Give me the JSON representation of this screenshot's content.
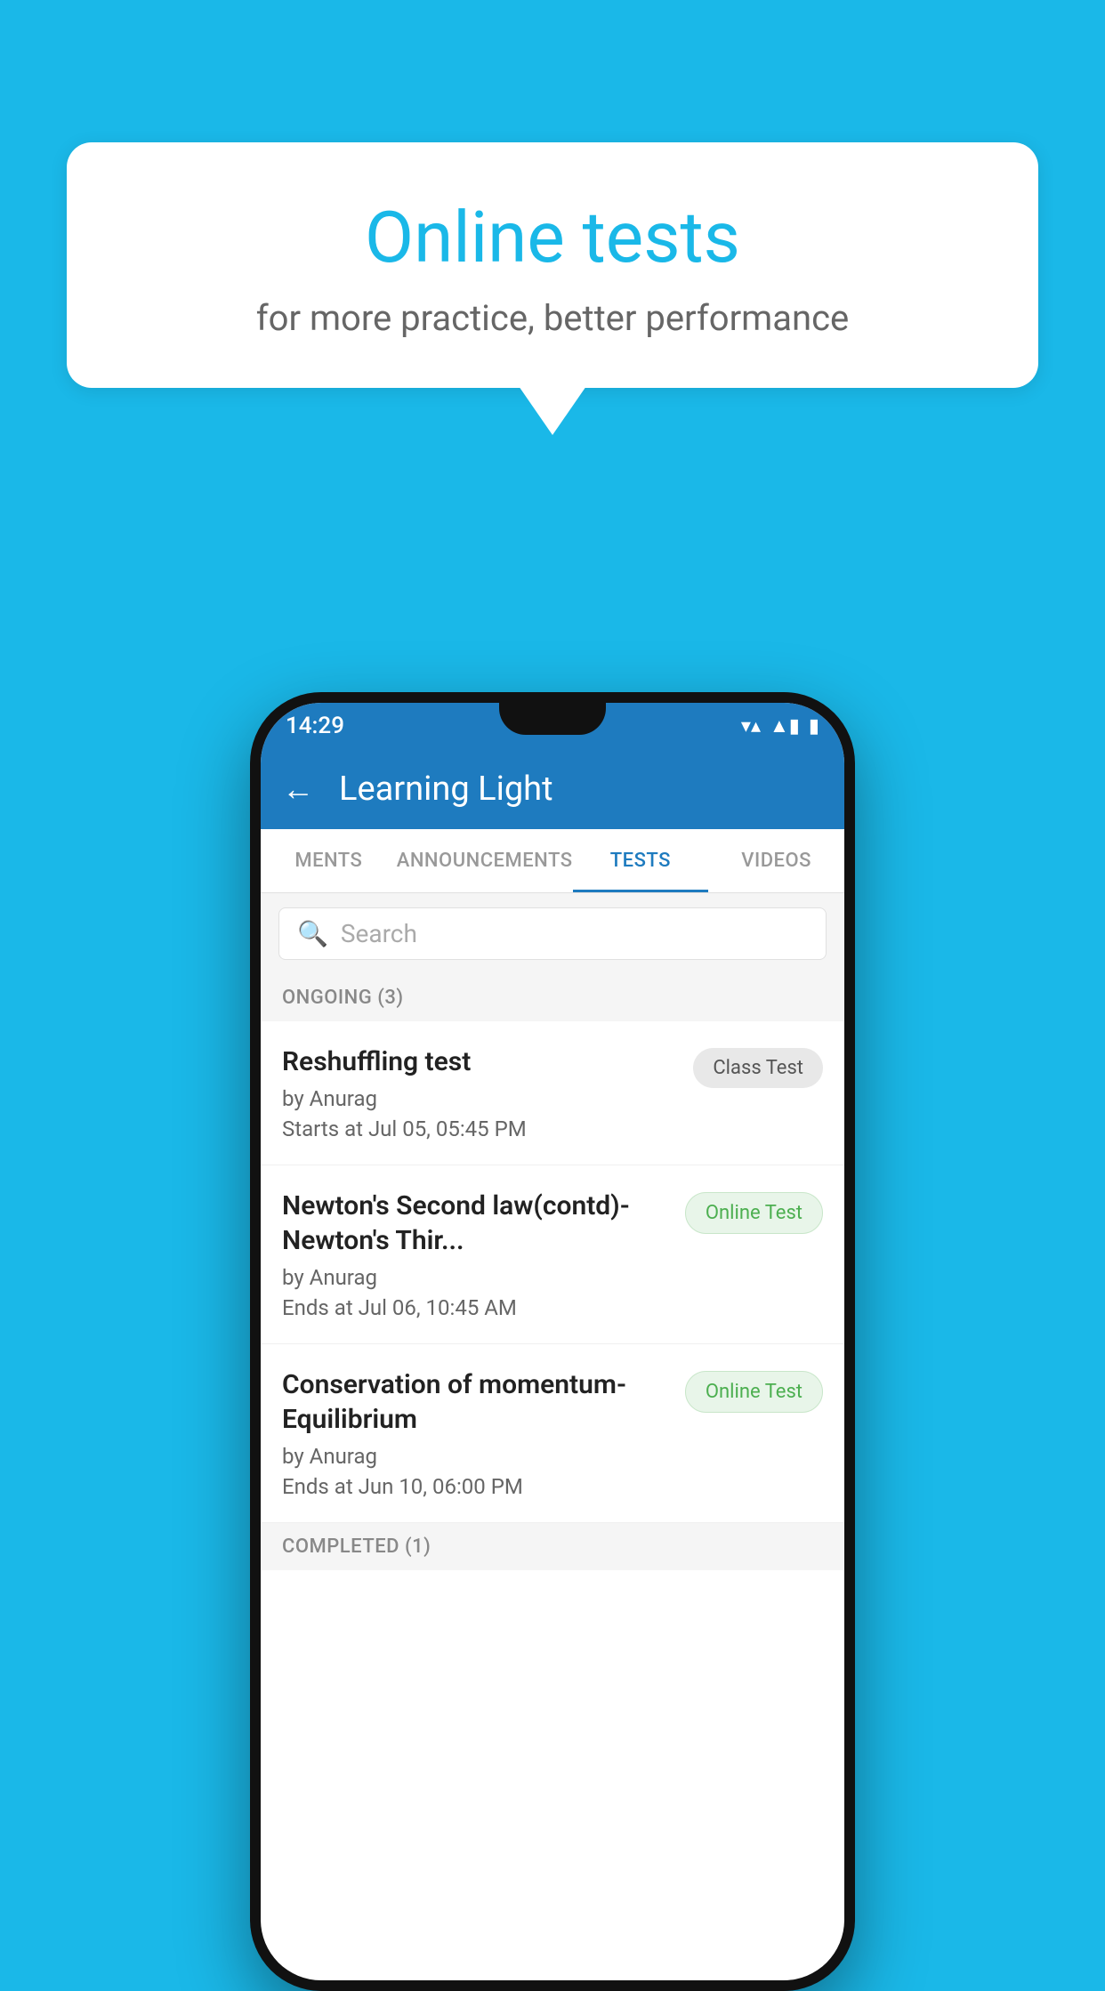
{
  "background": {
    "color": "#1ab8e8"
  },
  "speech_bubble": {
    "title": "Online tests",
    "subtitle": "for more practice, better performance"
  },
  "phone": {
    "status_bar": {
      "time": "14:29",
      "wifi_symbol": "▼",
      "signal_symbol": "▲",
      "battery_symbol": "▮"
    },
    "app_bar": {
      "back_label": "←",
      "title": "Learning Light"
    },
    "tabs": [
      {
        "label": "MENTS",
        "active": false
      },
      {
        "label": "ANNOUNCEMENTS",
        "active": false
      },
      {
        "label": "TESTS",
        "active": true
      },
      {
        "label": "VIDEOS",
        "active": false
      }
    ],
    "search": {
      "placeholder": "Search"
    },
    "section_ongoing": {
      "label": "ONGOING (3)"
    },
    "tests": [
      {
        "title": "Reshuffling test",
        "author": "by Anurag",
        "time_label": "Starts at",
        "time": "Jul 05, 05:45 PM",
        "badge": "Class Test",
        "badge_type": "class"
      },
      {
        "title": "Newton's Second law(contd)-Newton's Thir...",
        "author": "by Anurag",
        "time_label": "Ends at",
        "time": "Jul 06, 10:45 AM",
        "badge": "Online Test",
        "badge_type": "online"
      },
      {
        "title": "Conservation of momentum-Equilibrium",
        "author": "by Anurag",
        "time_label": "Ends at",
        "time": "Jun 10, 06:00 PM",
        "badge": "Online Test",
        "badge_type": "online"
      }
    ],
    "section_completed": {
      "label": "COMPLETED (1)"
    }
  }
}
